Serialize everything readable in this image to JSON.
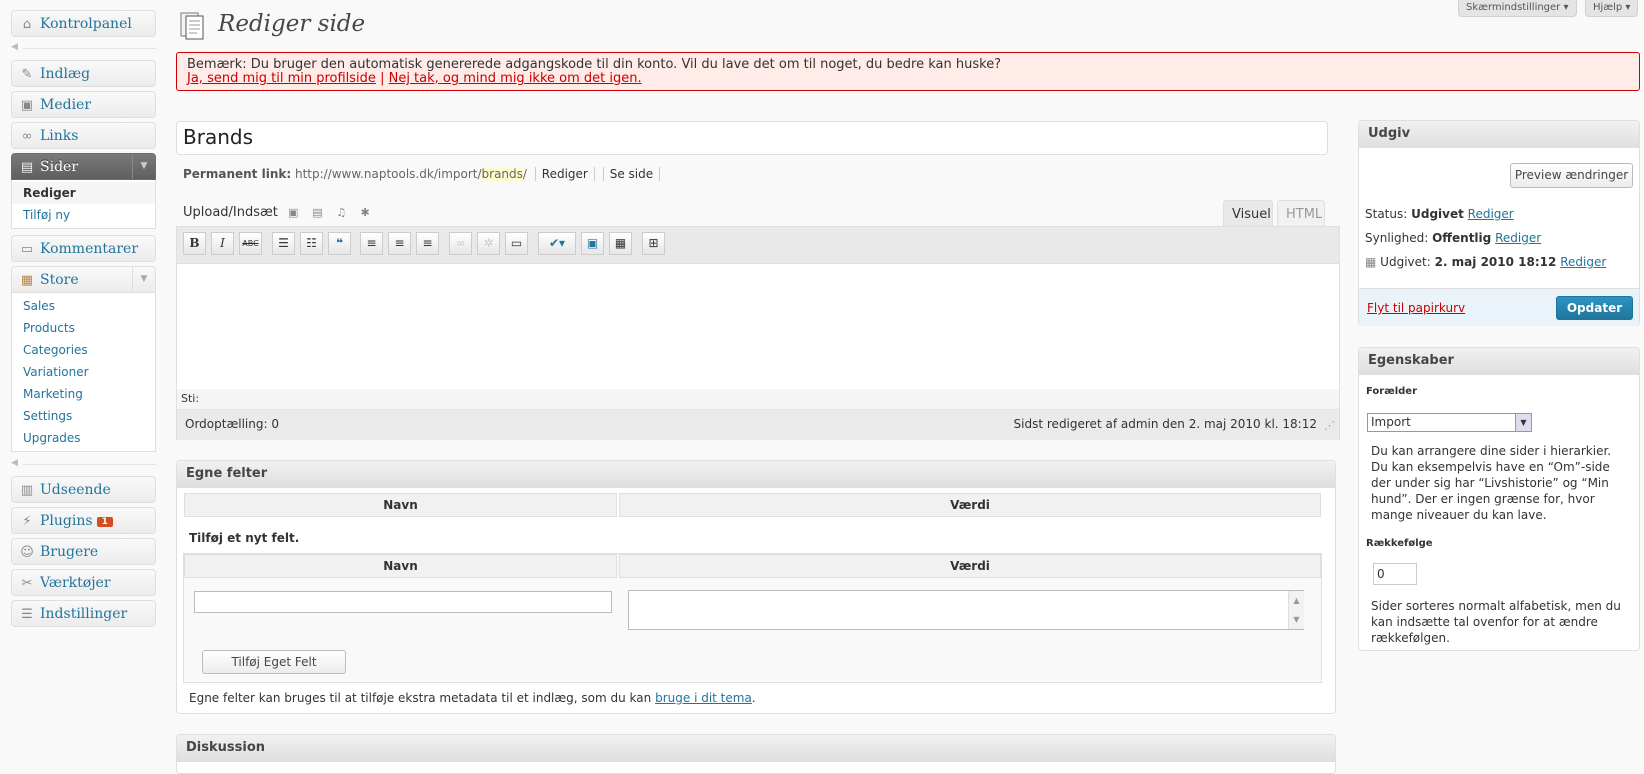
{
  "top_buttons": {
    "screen_options": "Skærmindstillinger ▾",
    "help": "Hjælp ▾"
  },
  "page_title": "Rediger side",
  "notice": {
    "text": "Bemærk: Du bruger den automatisk genererede adgangskode til din konto. Vil du lave det om til noget, du bedre kan huske?",
    "link_yes": "Ja, send mig til min profilside",
    "separator": "|",
    "link_no": "Nej tak, og mind mig ikke om det igen."
  },
  "sidebar": {
    "dashboard": "Kontrolpanel",
    "posts": "Indlæg",
    "media": "Medier",
    "links": "Links",
    "pages": "Sider",
    "pages_sub": [
      "Rediger",
      "Tilføj ny"
    ],
    "comments": "Kommentarer",
    "store": "Store",
    "store_sub": [
      "Sales",
      "Products",
      "Categories",
      "Variationer",
      "Marketing",
      "Settings",
      "Upgrades"
    ],
    "appearance": "Udseende",
    "plugins": "Plugins",
    "plugins_badge": "1",
    "users": "Brugere",
    "tools": "Værktøjer",
    "settings": "Indstillinger"
  },
  "post": {
    "title": "Brands",
    "permalink_label": "Permanent link:",
    "permalink_base": "http://www.naptools.dk/import/",
    "permalink_slug": "brands",
    "permalink_end": "/",
    "edit_btn": "Rediger",
    "view_btn": "Se side"
  },
  "editor": {
    "upload_label": "Upload/Indsæt",
    "tab_visual": "Visuel",
    "tab_html": "HTML",
    "path_label": "Sti:",
    "word_count": "Ordoptælling: 0",
    "last_edited": "Sidst redigeret af admin den 2. maj 2010 kl. 18:12",
    "toolbar": [
      "B",
      "I",
      "ABC"
    ]
  },
  "custom_fields": {
    "title": "Egne felter",
    "col_name": "Navn",
    "col_value": "Værdi",
    "add_new": "Tilføj et nyt felt.",
    "name_value": "",
    "value_value": "",
    "add_button": "Tilføj Eget Felt",
    "help_text": "Egne felter kan bruges til at tilføje ekstra metadata til et indlæg, som du kan",
    "help_link": "bruge i dit tema",
    "help_end": "."
  },
  "discussion": {
    "title": "Diskussion"
  },
  "publish": {
    "title": "Udgiv",
    "preview": "Preview ændringer",
    "status_label": "Status:",
    "status_value": "Udgivet",
    "visibility_label": "Synlighed:",
    "visibility_value": "Offentlig",
    "published_label": "Udgivet:",
    "published_value": "2. maj 2010 18:12",
    "edit_link": "Rediger",
    "trash": "Flyt til papirkurv",
    "update": "Opdater"
  },
  "attributes": {
    "title": "Egenskaber",
    "parent_label": "Forælder",
    "parent_value": "Import",
    "parent_help": "Du kan arrangere dine sider i hierarkier. Du kan eksempelvis have en “Om”-side der under sig har “Livshistorie” og “Min hund”. Der er ingen grænse for, hvor mange niveauer du kan lave.",
    "order_label": "Rækkefølge",
    "order_value": "0",
    "order_help": "Sider sorteres normalt alfabetisk, men du kan indsætte tal ovenfor for at ændre rækkefølgen."
  }
}
